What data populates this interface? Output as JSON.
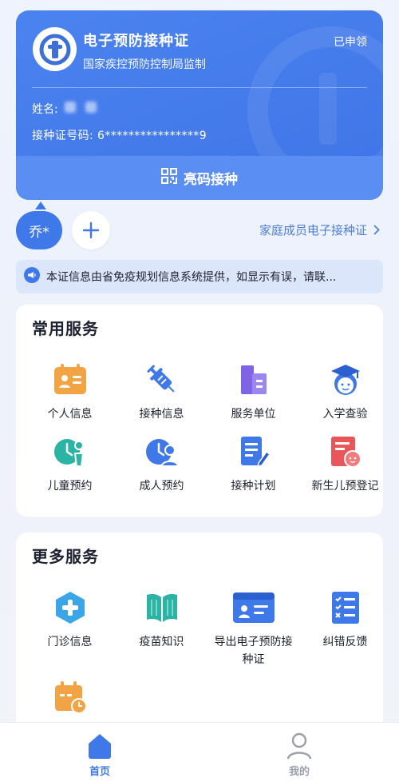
{
  "card": {
    "title": "电子预防接种证",
    "subtitle": "国家疾控预防控制局监制",
    "status": "已申领",
    "name_label": "姓名:",
    "id_label": "接种证号码:",
    "id_value": "6****************9",
    "show_code_label": "亮码接种"
  },
  "member": {
    "current": "乔*",
    "family_link": "家庭成员电子接种证"
  },
  "notice": {
    "text": "本证信息由省免疫规划信息系统提供，如显示有误，请联..."
  },
  "common_services": {
    "title": "常用服务",
    "items": [
      {
        "label": "个人信息",
        "icon": "id-card-icon"
      },
      {
        "label": "接种信息",
        "icon": "syringe-icon"
      },
      {
        "label": "服务单位",
        "icon": "building-icon"
      },
      {
        "label": "入学查验",
        "icon": "graduate-icon"
      },
      {
        "label": "儿童预约",
        "icon": "child-clock-icon"
      },
      {
        "label": "成人预约",
        "icon": "adult-clock-icon"
      },
      {
        "label": "接种计划",
        "icon": "plan-document-icon"
      },
      {
        "label": "新生儿预登记",
        "icon": "newborn-icon"
      }
    ]
  },
  "more_services": {
    "title": "更多服务",
    "items": [
      {
        "label": "门诊信息",
        "icon": "medical-cross-icon"
      },
      {
        "label": "疫苗知识",
        "icon": "book-icon"
      },
      {
        "label": "导出电子预防接种证",
        "icon": "export-card-icon"
      },
      {
        "label": "纠错反馈",
        "icon": "checklist-icon"
      },
      {
        "label": "",
        "icon": "calendar-clock-icon"
      }
    ]
  },
  "bottom_nav": {
    "home": "首页",
    "mine": "我的"
  },
  "colors": {
    "brand_blue": "#3f78e8",
    "orange": "#f0a33c",
    "teal": "#2bb3a3",
    "purple": "#7f64e6",
    "red": "#e8565a"
  }
}
